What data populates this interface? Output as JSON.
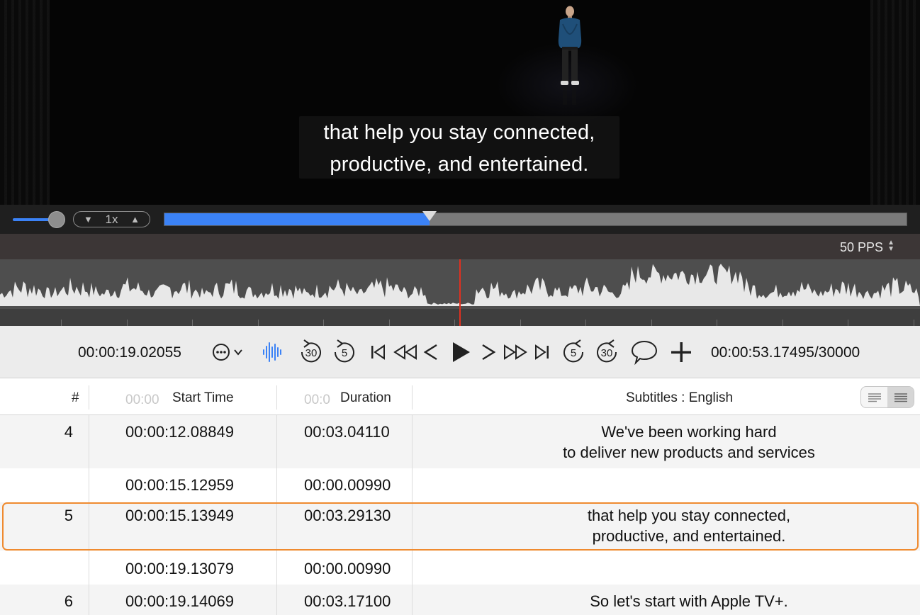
{
  "video": {
    "subtitle_line1": "that help you stay connected,",
    "subtitle_line2": "productive, and entertained."
  },
  "transport": {
    "speed_label": "1x",
    "progress_fraction": 0.357,
    "accent_color": "#3b82f6"
  },
  "waveform": {
    "pps_label": "50 PPS"
  },
  "toolbar": {
    "current_time": "00:00:19.02055",
    "total_time": "00:00:53.17495/30000",
    "icons": [
      "more-icon",
      "waveform-icon",
      "skip-back-30-icon",
      "skip-back-5-icon",
      "go-to-start-icon",
      "rewind-icon",
      "previous-frame-icon",
      "play-icon",
      "next-frame-icon",
      "fast-forward-icon",
      "go-to-end-icon",
      "skip-forward-5-icon",
      "skip-forward-30-icon",
      "comment-icon",
      "add-icon"
    ],
    "skip_30": "30",
    "skip_5": "5"
  },
  "table": {
    "headers": {
      "num": "#",
      "start": "Start Time",
      "duration": "Duration",
      "subtitles": "Subtitles : English",
      "start_ghost": "00:00",
      "duration_ghost": "00:0"
    },
    "rows": [
      {
        "num": "4",
        "start": "00:00:12.08849",
        "duration": "00:03.04110",
        "text1": "We've been working hard",
        "text2": "to deliver new products and services"
      },
      {
        "num": "",
        "start": "00:00:15.12959",
        "duration": "00:00.00990",
        "text1": "",
        "text2": ""
      },
      {
        "num": "5",
        "start": "00:00:15.13949",
        "duration": "00:03.29130",
        "text1": "that help you stay connected,",
        "text2": "productive, and entertained."
      },
      {
        "num": "",
        "start": "00:00:19.13079",
        "duration": "00:00.00990",
        "text1": "",
        "text2": ""
      },
      {
        "num": "6",
        "start": "00:00:19.14069",
        "duration": "00:03.17100",
        "text1": "So let's start with Apple TV+.",
        "text2": ""
      }
    ],
    "selected_color": "#ef8a2f"
  }
}
